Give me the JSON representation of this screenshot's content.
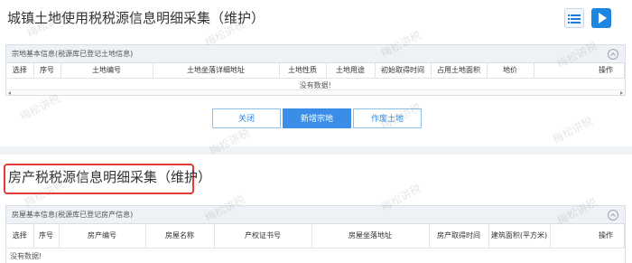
{
  "land": {
    "title": "城镇土地使用税税源信息明细采集（维护）",
    "section_title": "宗地基本信息(税源库已登记土地信息)",
    "columns": [
      "选择",
      "序号",
      "土地编号",
      "土地坐落详细地址",
      "土地性质",
      "土地用途",
      "初始取得时间",
      "占用土地面积",
      "地价",
      "操作"
    ],
    "empty_text": "没有数据!"
  },
  "buttons": {
    "close": "关闭",
    "add": "新增宗地",
    "void": "作废土地"
  },
  "house": {
    "title": "房产税税源信息明细采集（维护）",
    "section_title": "房屋基本信息(税源库已登记房产信息)",
    "columns": [
      "选择",
      "序号",
      "房产编号",
      "房屋名称",
      "产权证书号",
      "房屋坐落地址",
      "房产取得时间",
      "建筑面积(平方米)",
      "操作"
    ],
    "empty_text": "没有数据!"
  },
  "watermark": "梅松讲税",
  "colors": {
    "primary": "#3a8ee8",
    "highlight_border": "#e23c36",
    "header_bg": "#eef1f5"
  },
  "icons": [
    "list-icon",
    "video-icon",
    "collapse-icon"
  ]
}
